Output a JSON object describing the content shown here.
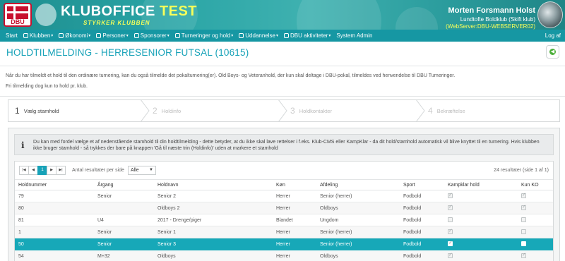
{
  "header": {
    "logo_text": "DBU",
    "brand": "KLUBOFFICE",
    "brand_badge": "TEST",
    "brand_sub": "STYRKER KLUBBEN",
    "user_name": "Morten Forsmann Holst",
    "user_club": "Lundtofte Boldklub (Skift klub)",
    "user_server": "(WebServer:DBU-WEBSERVER02)"
  },
  "nav": {
    "items": [
      {
        "label": "Start",
        "icon": "",
        "caret": false
      },
      {
        "label": "Klubben",
        "icon": "home-icon",
        "caret": true
      },
      {
        "label": "Økonomi",
        "icon": "money-icon",
        "caret": true
      },
      {
        "label": "Personer",
        "icon": "person-icon",
        "caret": true
      },
      {
        "label": "Sponsorer",
        "icon": "sponsor-icon",
        "caret": true
      },
      {
        "label": "Turneringer og hold",
        "icon": "tournament-icon",
        "caret": true
      },
      {
        "label": "Uddannelse",
        "icon": "education-icon",
        "caret": true
      },
      {
        "label": "DBU aktiviteter",
        "icon": "activity-icon",
        "caret": true
      },
      {
        "label": "System Admin",
        "icon": "",
        "caret": false
      }
    ],
    "logout": "Log af"
  },
  "page": {
    "title": "HOLDTILMELDING - HERRESENIOR FUTSAL (10615)",
    "intro_1": "Når du har tilmeldt et hold til den ordinære turnering, kan du også tilmelde det pokalturnering(er). Old Boys- og Veteranhold, der kun skal deltage i DBU-pokal, tilmeldes ved henvendelse til DBU Turneringer.",
    "intro_2": "Fri tilmelding dog kun to hold pr. klub."
  },
  "stepper": [
    {
      "num": "1",
      "label": "Vælg stamhold",
      "active": true
    },
    {
      "num": "2",
      "label": "Holdinfo",
      "active": false
    },
    {
      "num": "3",
      "label": "Holdkontakter",
      "active": false
    },
    {
      "num": "4",
      "label": "Bekræftelse",
      "active": false
    }
  ],
  "info_text": "Du kan med fordel vælge et af nedenstående stamhold til din holdtilmelding - dette betyder, at du ikke skal lave rettelser i f.eks. Klub-CMS eller KampKlar - da dit hold/stamhold automatisk vil blive knyttet til en turnering. Hvis klubben ikke bruger stamhold - så trykkes der bare på knappen 'Gå til næste trin (Holdinfo)' uden at markere et stamhold",
  "pager": {
    "current_page": "1",
    "per_page_label": "Antal resultater per side",
    "per_page_value": "Alle",
    "results": "24 resultater (side 1 af 1)"
  },
  "table": {
    "columns": [
      "Holdnummer",
      "Årgang",
      "Holdnavn",
      "Køn",
      "Afdeling",
      "Sport",
      "Kampklar hold",
      "Kun KO"
    ],
    "rows": [
      {
        "holdnummer": "79",
        "aargang": "Senior",
        "holdnavn": "Senior 2",
        "koen": "Herrer",
        "afdeling": "Senior (herrer)",
        "sport": "Fodbold",
        "kampklar": true,
        "kunko": true,
        "selected": false
      },
      {
        "holdnummer": "80",
        "aargang": "",
        "holdnavn": "Oldboys 2",
        "koen": "Herrer",
        "afdeling": "Oldboys",
        "sport": "Fodbold",
        "kampklar": true,
        "kunko": true,
        "selected": false
      },
      {
        "holdnummer": "81",
        "aargang": "U4",
        "holdnavn": "2017 - Drenge/piger",
        "koen": "Blandet",
        "afdeling": "Ungdom",
        "sport": "Fodbold",
        "kampklar": false,
        "kunko": false,
        "selected": false
      },
      {
        "holdnummer": "1",
        "aargang": "Senior",
        "holdnavn": "Senior 1",
        "koen": "Herrer",
        "afdeling": "Senior (herrer)",
        "sport": "Fodbold",
        "kampklar": true,
        "kunko": false,
        "selected": false
      },
      {
        "holdnummer": "50",
        "aargang": "Senior",
        "holdnavn": "Senior 3",
        "koen": "Herrer",
        "afdeling": "Senior (herrer)",
        "sport": "Fodbold",
        "kampklar": true,
        "kunko": false,
        "selected": true
      },
      {
        "holdnummer": "54",
        "aargang": "M+32",
        "holdnavn": "Oldboys",
        "koen": "Herrer",
        "afdeling": "Oldboys",
        "sport": "Fodbold",
        "kampklar": true,
        "kunko": true,
        "selected": false
      }
    ]
  }
}
